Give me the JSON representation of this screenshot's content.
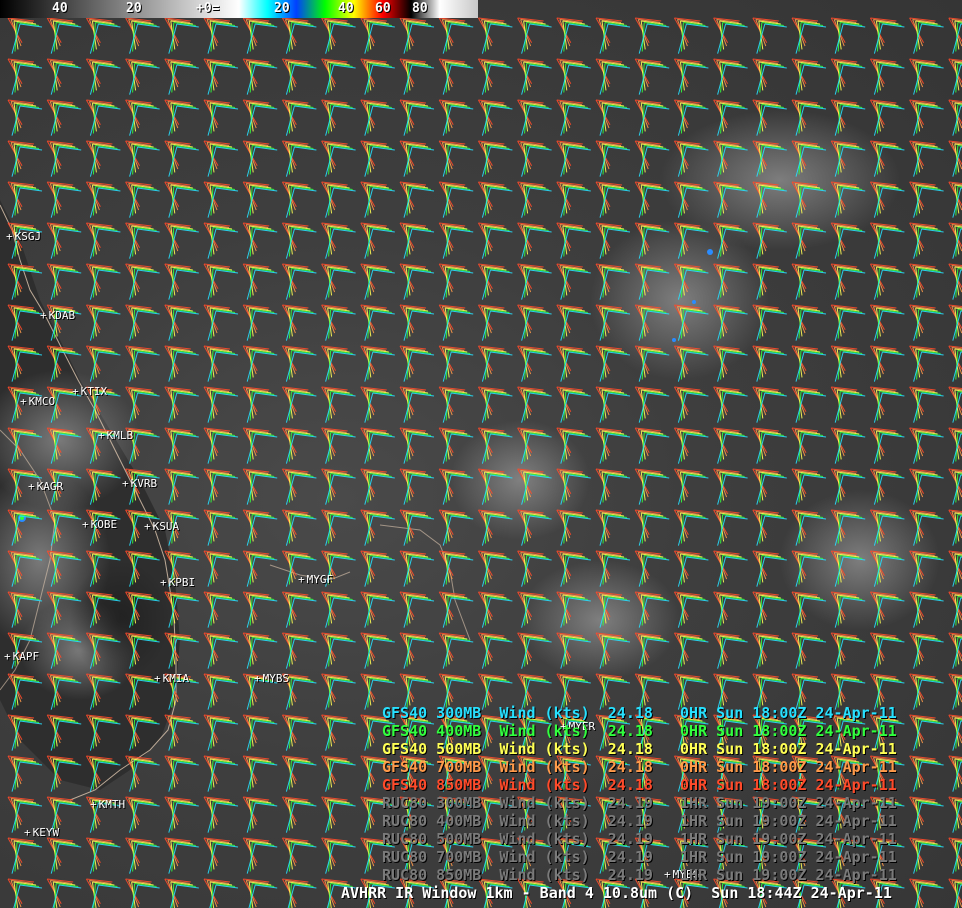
{
  "colorbar": {
    "labels": [
      "40",
      "20",
      "+0=",
      "20",
      "40",
      "60",
      "80"
    ]
  },
  "stations": [
    {
      "id": "KSGJ"
    },
    {
      "id": "KDAB"
    },
    {
      "id": "KTIX"
    },
    {
      "id": "KMCO"
    },
    {
      "id": "KMLB"
    },
    {
      "id": "KVRB"
    },
    {
      "id": "KAGR"
    },
    {
      "id": "KOBE"
    },
    {
      "id": "KSUA"
    },
    {
      "id": "MYGF"
    },
    {
      "id": "KPBI"
    },
    {
      "id": "KAPF"
    },
    {
      "id": "KMIA"
    },
    {
      "id": "MYBS"
    },
    {
      "id": "MYER"
    },
    {
      "id": "KMTH"
    },
    {
      "id": "KEYW"
    },
    {
      "id": "MYEG"
    }
  ],
  "legend": [
    {
      "text": "GFS40 300MB  Wind (kts)  24.18   0HR Sun 18:00Z 24-Apr-11",
      "color": "#27e0ff"
    },
    {
      "text": "GFS40 400MB  Wind (kts)  24.18   0HR Sun 18:00Z 24-Apr-11",
      "color": "#31ff3e"
    },
    {
      "text": "GFS40 500MB  Wind (kts)  24.18   0HR Sun 18:00Z 24-Apr-11",
      "color": "#ffff55"
    },
    {
      "text": "GFS40 700MB  Wind (kts)  24.18   0HR Sun 18:00Z 24-Apr-11",
      "color": "#ff9a4a"
    },
    {
      "text": "GFS40 850MB  Wind (kts)  24.18   0HR Sun 18:00Z 24-Apr-11",
      "color": "#ff4a2a"
    },
    {
      "text": "RUC80 300MB  Wind (kts)  24.19   1HR Sun 19:00Z 24-Apr-11",
      "color": "#7a7a7a"
    },
    {
      "text": "RUC80 400MB  Wind (kts)  24.19   1HR Sun 19:00Z 24-Apr-11",
      "color": "#7a7a7a"
    },
    {
      "text": "RUC80 500MB  Wind (kts)  24.19   1HR Sun 19:00Z 24-Apr-11",
      "color": "#7a7a7a"
    },
    {
      "text": "RUC80 700MB  Wind (kts)  24.19   1HR Sun 19:00Z 24-Apr-11",
      "color": "#7a7a7a"
    },
    {
      "text": "RUC80 850MB  Wind (kts)  24.19   1HR Sun 19:00Z 24-Apr-11",
      "color": "#7a7a7a"
    }
  ],
  "footer": {
    "text": "AVHRR IR Window 1km - Band 4 10.8um (C)  Sun 18:44Z 24-Apr-11",
    "color": "#ffffff"
  },
  "barb_colors": {
    "gfs300": "#27e0ff",
    "gfs400": "#31ff3e",
    "gfs500": "#ffff55",
    "gfs700": "#ff9a4a",
    "gfs850": "#ff4a2a"
  }
}
